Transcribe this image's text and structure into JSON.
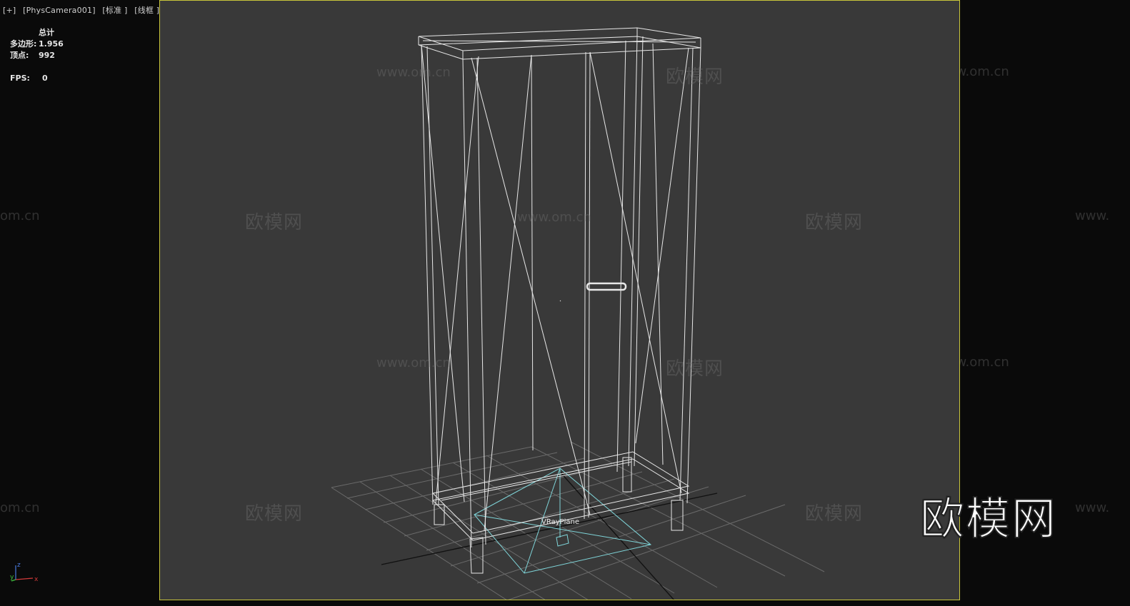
{
  "viewport": {
    "menu_plus": "[+]",
    "camera": "[PhysCamera001]",
    "shading_mode": "[标准 ]",
    "display_mode": "[线框 ]"
  },
  "stats": {
    "header": "总计",
    "polys_label": "多边形:",
    "polys_value": "1.956",
    "verts_label": "顶点:",
    "verts_value": "992",
    "fps_label": "FPS:",
    "fps_value": "0"
  },
  "scene": {
    "object_label": "VRayPlane",
    "wire_color": "#e8e8e8",
    "plane_color": "#7fd4d8",
    "grid_color": "#6a6a6a",
    "viewport_bg": "#393939",
    "border_color": "#c8c53a"
  },
  "watermarks": {
    "cn": "欧模网",
    "url": "www.om.cn",
    "url_partial_right": "www.",
    "url_partial_left": "om.cn"
  },
  "brand": "欧模网",
  "gizmo": {
    "x": "x",
    "y": "y",
    "z": "z"
  }
}
